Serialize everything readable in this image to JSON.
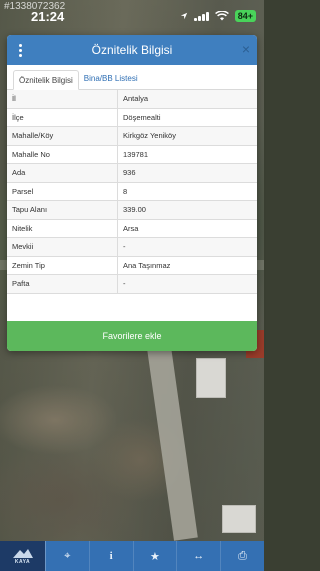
{
  "watermark_id": "#1338072362",
  "status_bar": {
    "time": "21:24",
    "battery": "84+"
  },
  "modal": {
    "title": "Öznitelik Bilgisi",
    "close_glyph": "×",
    "tabs": [
      {
        "label": "Öznitelik Bilgisi",
        "active": true
      },
      {
        "label": "Bina/BB Listesi",
        "active": false
      }
    ],
    "rows": [
      {
        "key": "İl",
        "value": "Antalya"
      },
      {
        "key": "İlçe",
        "value": "Döşemealti"
      },
      {
        "key": "Mahalle/Köy",
        "value": "Kirkgöz Yeniköy"
      },
      {
        "key": "Mahalle No",
        "value": "139781"
      },
      {
        "key": "Ada",
        "value": "936"
      },
      {
        "key": "Parsel",
        "value": "8"
      },
      {
        "key": "Tapu Alanı",
        "value": "339.00"
      },
      {
        "key": "Nitelik",
        "value": "Arsa"
      },
      {
        "key": "Mevkii",
        "value": "-"
      },
      {
        "key": "Zemin Tip",
        "value": "Ana Taşınmaz"
      },
      {
        "key": "Pafta",
        "value": "-"
      }
    ],
    "favorite_button": "Favorilere ekle"
  },
  "toolbar": {
    "logo_text": "KAYA",
    "buttons": [
      {
        "icon": "crosshair-icon",
        "glyph": "⌖"
      },
      {
        "icon": "info-icon",
        "glyph": "i"
      },
      {
        "icon": "star-icon",
        "glyph": "★"
      },
      {
        "icon": "measure-icon",
        "glyph": "↔"
      },
      {
        "icon": "print-icon",
        "glyph": "⎙"
      }
    ]
  },
  "colors": {
    "header": "#3f7fbf",
    "button": "#5cb85c",
    "toolbar": "#3470b3"
  }
}
